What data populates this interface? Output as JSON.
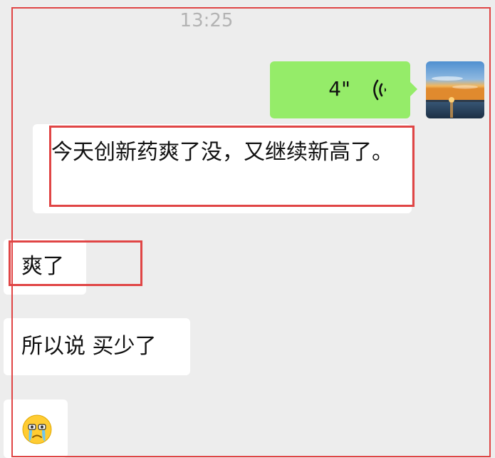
{
  "chat": {
    "timestamp": "13:25",
    "messages": [
      {
        "sender": "self",
        "type": "voice",
        "duration": "4\"",
        "icon": "voice-wave-icon"
      },
      {
        "sender": "other",
        "type": "text",
        "text": "今天创新药爽了没，又继续新高了。"
      },
      {
        "sender": "other",
        "type": "text",
        "text": "爽了"
      },
      {
        "sender": "other",
        "type": "text",
        "text": "所以说 买少了"
      },
      {
        "sender": "other",
        "type": "emoji",
        "icon": "crying-emoji-icon"
      }
    ]
  },
  "colors": {
    "background": "#ededed",
    "self_bubble": "#95ec69",
    "other_bubble": "#ffffff",
    "annotation": "#e04545"
  }
}
